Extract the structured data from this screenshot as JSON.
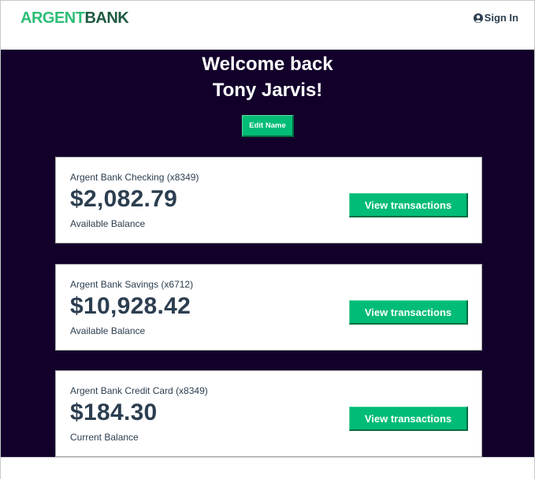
{
  "header": {
    "logo_part1": "ARGENT",
    "logo_part2": "BANK",
    "sign_in_label": "Sign In"
  },
  "welcome": {
    "line1": "Welcome back",
    "line2": "Tony Jarvis!",
    "edit_name_label": "Edit Name"
  },
  "accounts": [
    {
      "title": "Argent Bank Checking (x8349)",
      "amount": "$2,082.79",
      "description": "Available Balance",
      "button_label": "View transactions"
    },
    {
      "title": "Argent Bank Savings (x6712)",
      "amount": "$10,928.42",
      "description": "Available Balance",
      "button_label": "View transactions"
    },
    {
      "title": "Argent Bank Credit Card (x8349)",
      "amount": "$184.30",
      "description": "Current Balance",
      "button_label": "View transactions"
    }
  ],
  "colors": {
    "brand_green": "#00bc77",
    "brand_dark_green": "#1e5a3e",
    "background_dark": "#12002b",
    "text_dark": "#2c3e50"
  },
  "icons": {
    "sign_in": "user-circle-icon"
  }
}
